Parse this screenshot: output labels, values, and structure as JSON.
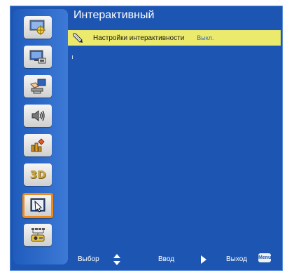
{
  "colors": {
    "panel_bg": "#1d56b2",
    "highlight_row": "#ecea6c",
    "selected_border": "#f08a1a",
    "value_text": "#3a6bb8"
  },
  "sidebar": {
    "items": [
      {
        "icon": "image-settings-icon"
      },
      {
        "icon": "display-settings-icon"
      },
      {
        "icon": "setup-icon"
      },
      {
        "icon": "audio-icon"
      },
      {
        "icon": "options-icon"
      },
      {
        "icon": "3d-icon",
        "label": "3D"
      },
      {
        "icon": "interactive-icon",
        "selected": true
      },
      {
        "icon": "network-icon"
      }
    ]
  },
  "header": {
    "title": "Интерактивный"
  },
  "menu": {
    "rows": [
      {
        "icon": "pen-icon",
        "label": "Настройки интерактивности",
        "value": "Выкл."
      }
    ]
  },
  "footer": {
    "select_label": "Выбор",
    "enter_label": "Ввод",
    "exit_label": "Выход",
    "menu_key_label": "Menu"
  }
}
